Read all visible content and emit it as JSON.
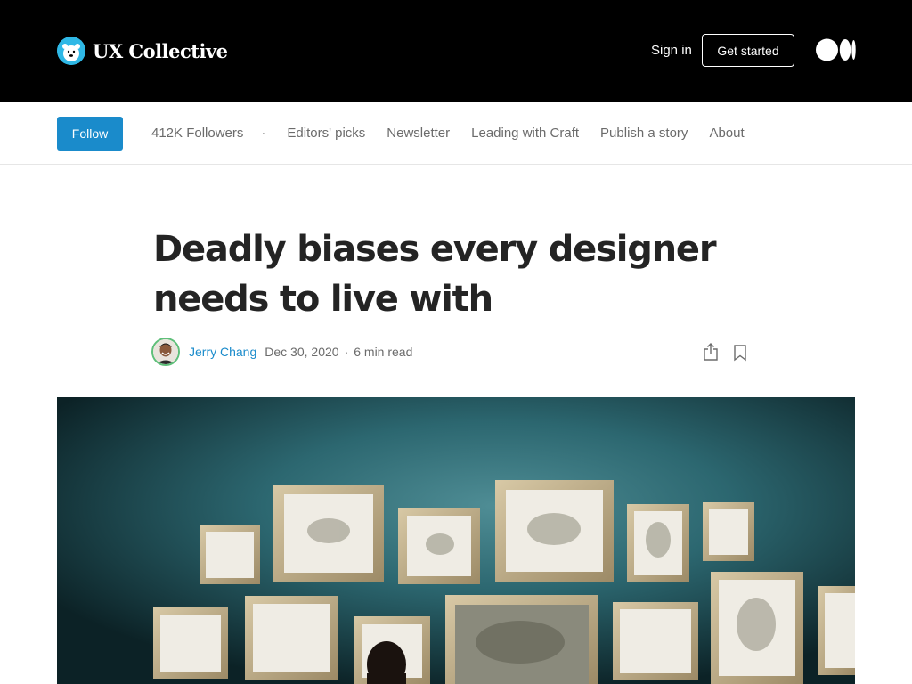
{
  "header": {
    "brand_name": "UX Collective",
    "signin_label": "Sign in",
    "get_started_label": "Get started",
    "logo_icon": "polar-bear-icon",
    "medium_icon": "medium-logo-icon"
  },
  "pubnav": {
    "follow_label": "Follow",
    "followers": "412K Followers",
    "separator": "·",
    "links": [
      "Editors' picks",
      "Newsletter",
      "Leading with Craft",
      "Publish a story",
      "About"
    ]
  },
  "article": {
    "title": "Deadly biases every designer needs to live with",
    "author": "Jerry Chang",
    "date": "Dec 30, 2020",
    "byline_separator": "·",
    "read_time": "6 min read",
    "share_icon": "share-icon",
    "bookmark_icon": "bookmark-icon"
  },
  "colors": {
    "topbar": "#000000",
    "accent": "#1a8bcb",
    "text": "#242424",
    "muted": "#6b6b6b",
    "wall": "#1e4b52"
  }
}
